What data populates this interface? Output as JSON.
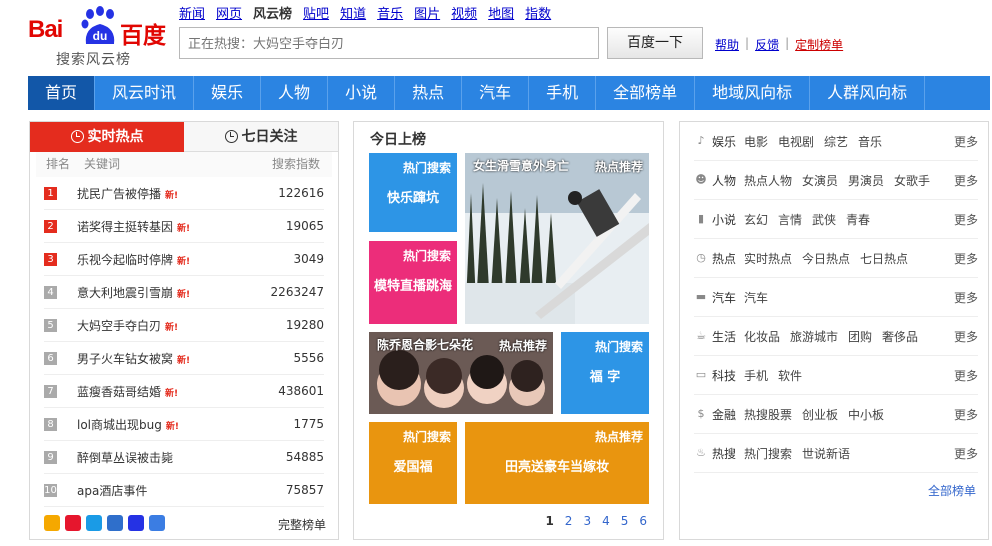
{
  "logo": {
    "word": "Bai",
    "du": "du",
    "zh": "百度",
    "sub": "搜索风云榜"
  },
  "topnav": [
    "新闻",
    "网页",
    "风云榜",
    "贴吧",
    "知道",
    "音乐",
    "图片",
    "视频",
    "地图",
    "指数"
  ],
  "topnav_current": "风云榜",
  "search": {
    "placeholder": "正在热搜：大妈空手夺白刃",
    "button": "百度一下"
  },
  "toplinks": {
    "help": "帮助",
    "feedback": "反馈",
    "custom": "定制榜单",
    "sep": "|"
  },
  "mainnav": [
    "首页",
    "风云时讯",
    "娱乐",
    "人物",
    "小说",
    "热点",
    "汽车",
    "手机",
    "全部榜单",
    "地域风向标",
    "人群风向标"
  ],
  "left": {
    "tab_live": "实时热点",
    "tab_week": "七日关注",
    "head_rank": "排名",
    "head_kw": "关键词",
    "head_idx": "搜索指数",
    "new_label": "新!",
    "rows": [
      {
        "rank": "1",
        "kw": "扰民广告被停播",
        "new": true,
        "idx": "122616"
      },
      {
        "rank": "2",
        "kw": "诺奖得主挺转基因",
        "new": true,
        "idx": "19065"
      },
      {
        "rank": "3",
        "kw": "乐视今起临时停牌",
        "new": true,
        "idx": "3049"
      },
      {
        "rank": "4",
        "kw": "意大利地震引雪崩",
        "new": true,
        "idx": "2263247"
      },
      {
        "rank": "5",
        "kw": "大妈空手夺白刃",
        "new": true,
        "idx": "19280"
      },
      {
        "rank": "6",
        "kw": "男子火车钻女被窝",
        "new": true,
        "idx": "5556"
      },
      {
        "rank": "7",
        "kw": "蓝瘦香菇哥结婚",
        "new": true,
        "idx": "438601"
      },
      {
        "rank": "8",
        "kw": "lol商城出现bug",
        "new": true,
        "idx": "1775"
      },
      {
        "rank": "9",
        "kw": "醉倒草丛误被击毙",
        "new": false,
        "idx": "54885"
      },
      {
        "rank": "10",
        "kw": "apa酒店事件",
        "new": false,
        "idx": "75857"
      }
    ],
    "full_link": "完整榜单"
  },
  "middle": {
    "title": "今日上榜",
    "tile_hot": "热门搜索",
    "tile_rec": "热点推荐",
    "t1": "快乐蹿坑",
    "t2": "模特直播跳海",
    "t3": "福 字",
    "t4": "爱国福",
    "t5": "田亮送豪车当嫁妆",
    "photo1_cap": "女生滑雪意外身亡",
    "photo2_cap": "陈乔恩合影七朵花",
    "pages": [
      "1",
      "2",
      "3",
      "4",
      "5",
      "6"
    ]
  },
  "right": {
    "more": "更多",
    "all": "全部榜单",
    "cats": [
      {
        "icon": "music-icon",
        "name": "娱乐",
        "items": [
          "电影",
          "电视剧",
          "综艺",
          "音乐"
        ]
      },
      {
        "icon": "person-icon",
        "name": "人物",
        "items": [
          "热点人物",
          "女演员",
          "男演员",
          "女歌手"
        ]
      },
      {
        "icon": "book-icon",
        "name": "小说",
        "items": [
          "玄幻",
          "言情",
          "武侠",
          "青春"
        ]
      },
      {
        "icon": "clock-icon",
        "name": "热点",
        "items": [
          "实时热点",
          "今日热点",
          "七日热点"
        ]
      },
      {
        "icon": "car-icon",
        "name": "汽车",
        "items": [
          "汽车"
        ]
      },
      {
        "icon": "cup-icon",
        "name": "生活",
        "items": [
          "化妆品",
          "旅游城市",
          "团购",
          "奢侈品"
        ]
      },
      {
        "icon": "monitor-icon",
        "name": "科技",
        "items": [
          "手机",
          "软件"
        ]
      },
      {
        "icon": "dollar-icon",
        "name": "金融",
        "items": [
          "热搜股票",
          "创业板",
          "中小板"
        ]
      },
      {
        "icon": "flame-icon",
        "name": "热搜",
        "items": [
          "热门搜索",
          "世说新语"
        ]
      }
    ]
  },
  "colors": {
    "brand_red": "#e42c1e",
    "nav_blue": "#2b84e2",
    "nav_active": "#1257a8",
    "tile_blue": "#2d95e6",
    "tile_pink": "#ec2d7a",
    "tile_orange": "#e9950f"
  }
}
